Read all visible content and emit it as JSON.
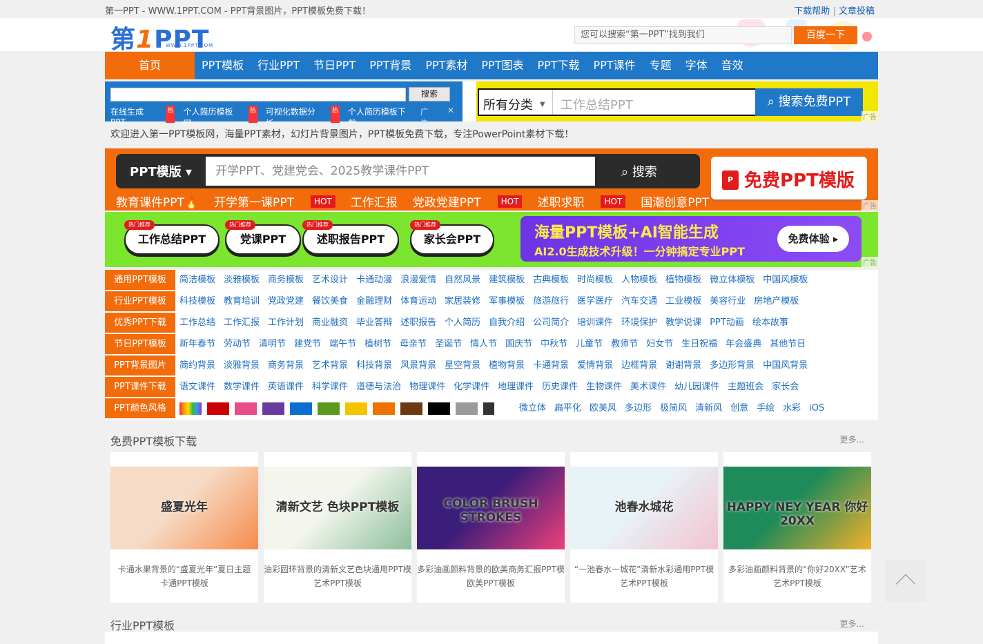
{
  "topbar": {
    "site_title": "第一PPT - WWW.1PPT.COM - PPT背景图片，PPT模板免费下载！",
    "help": "下载帮助",
    "sep": "|",
    "submit": "文章投稿"
  },
  "header": {
    "logo_a": "第",
    "logo_b": "1",
    "logo_c": "PPT",
    "logo_url": "WWW.1PPT.COM",
    "search_placeholder": "您可以搜索“第一PPT”找到我们",
    "search_button": "百度一下"
  },
  "nav": {
    "home": "首页",
    "items": [
      "PPT模板",
      "行业PPT",
      "节日PPT",
      "PPT背景",
      "PPT素材",
      "PPT图表",
      "PPT下载",
      "PPT课件",
      "专题",
      "字体",
      "音效"
    ]
  },
  "search1": {
    "button": "搜索",
    "links": [
      "在线生成PPT",
      "个人简历模板网",
      "可视化数据分析",
      "个人简历模板下载"
    ],
    "hot": "热",
    "ad": "广告",
    "close": "✕"
  },
  "search2": {
    "category": "所有分类",
    "placeholder": "工作总结PPT",
    "button": "搜索免费PPT",
    "ad": "广告"
  },
  "welcome": "欢迎进入第一PPT模板网，海量PPT素材，幻灯片背景图片，PPT模板免费下载，专注PowerPoint素材下载！",
  "banner1": {
    "category": "PPT模版 ▾",
    "placeholder": "开学PPT、党建党会、2025教学课件PPT",
    "button": "搜索",
    "tags": [
      "教育课件PPT🔥",
      "开学第一课PPT",
      "工作汇报",
      "党政党建PPT",
      "述职求职",
      "国潮创意PPT"
    ],
    "hot": "HOT",
    "right_title": "免费PPT模版",
    "pdf": "P",
    "ad": "广告"
  },
  "banner2": {
    "pills": [
      "工作总结PPT",
      "党课PPT",
      "述职报告PPT",
      "家长会PPT"
    ],
    "pill_tag": "热门推荐",
    "ad_title": "海量PPT模板+AI智能生成",
    "ad_sub": "AI2.0生成技术升级！一分钟搞定专业PPT",
    "ad_button": "免费体验 ▸",
    "ad": "广告"
  },
  "categories": [
    {
      "label": "通用PPT模板",
      "items": [
        "简洁模板",
        "淡雅模板",
        "商务模板",
        "艺术设计",
        "卡通动漫",
        "浪漫爱情",
        "自然风景",
        "建筑模板",
        "古典模板",
        "时尚模板",
        "人物模板",
        "植物模板",
        "微立体模板",
        "中国风模板"
      ]
    },
    {
      "label": "行业PPT模板",
      "items": [
        "科技模板",
        "教育培训",
        "党政党建",
        "餐饮美食",
        "金融理财",
        "体育运动",
        "家居装修",
        "军事模板",
        "旅游旅行",
        "医学医疗",
        "汽车交通",
        "工业模板",
        "美容行业",
        "房地产模板"
      ]
    },
    {
      "label": "优秀PPT下载",
      "items": [
        "工作总结",
        "工作汇报",
        "工作计划",
        "商业融资",
        "毕业答辩",
        "述职报告",
        "个人简历",
        "自我介绍",
        "公司简介",
        "培训课件",
        "环境保护",
        "教学说课",
        "PPT动画",
        "绘本故事"
      ]
    },
    {
      "label": "节日PPT模板",
      "items": [
        "新年春节",
        "劳动节",
        "清明节",
        "建党节",
        "端午节",
        "植树节",
        "母亲节",
        "圣诞节",
        "情人节",
        "国庆节",
        "中秋节",
        "儿童节",
        "教师节",
        "妇女节",
        "生日祝福",
        "年会盛典",
        "其他节日"
      ]
    },
    {
      "label": "PPT背景图片",
      "items": [
        "简约背景",
        "淡雅背景",
        "商务背景",
        "艺术背景",
        "科技背景",
        "风景背景",
        "星空背景",
        "植物背景",
        "卡通背景",
        "爱情背景",
        "边框背景",
        "谢谢背景",
        "多边形背景",
        "中国风背景"
      ]
    },
    {
      "label": "PPT课件下载",
      "items": [
        "语文课件",
        "数学课件",
        "英语课件",
        "科学课件",
        "道德与法治",
        "物理课件",
        "化学课件",
        "地理课件",
        "历史课件",
        "生物课件",
        "美术课件",
        "幼儿园课件",
        "主题班会",
        "家长会"
      ]
    }
  ],
  "colors": {
    "label": "PPT颜色风格",
    "swatches": [
      "#cc0000",
      "#e84c8b",
      "#6b3aa0",
      "#0a6fd1",
      "#5b9a1c",
      "#f5c400",
      "#f07000",
      "#6b3a10",
      "#000000",
      "#9a9a9a"
    ],
    "styles": [
      "微立体",
      "扁平化",
      "欧美风",
      "多边形",
      "极简风",
      "清新风",
      "创意",
      "手绘",
      "水彩",
      "iOS"
    ]
  },
  "section1": {
    "title": "免费PPT模板下载",
    "more": "更多..."
  },
  "cards": [
    {
      "line1": "卡通水果背景的“盛夏光年”夏日主题",
      "line2": "卡通PPT模板",
      "img_text": "盛夏光年",
      "c1": "#f6dcc6",
      "c2": "#f58b4c"
    },
    {
      "line1": "油彩圆环背景的清新文艺色块通用PPT模",
      "line2": "艺术PPT模板",
      "img_text": "清新文艺 色块PPT模板",
      "c1": "#f4f6ee",
      "c2": "#8bbf9a"
    },
    {
      "line1": "多彩油画颜料背景的欧美商务汇报PPT模",
      "line2": "欧美PPT模板",
      "img_text": "COLOR BRUSH STROKES",
      "c1": "#3b1d7a",
      "c2": "#f0407a"
    },
    {
      "line1": "“一池春水一城花”清新水彩通用PPT模",
      "line2": "艺术PPT模板",
      "img_text": "池春水城花",
      "c1": "#e8f3f8",
      "c2": "#f2c3cf"
    },
    {
      "line1": "多彩油画颜料背景的“你好20XX”艺术",
      "line2": "艺术PPT模板",
      "img_text": "HAPPY NEY YEAR 你好20XX",
      "c1": "#1f8a5a",
      "c2": "#f1b12b"
    }
  ],
  "section2": {
    "title": "行业PPT模板",
    "more": "更多..."
  }
}
